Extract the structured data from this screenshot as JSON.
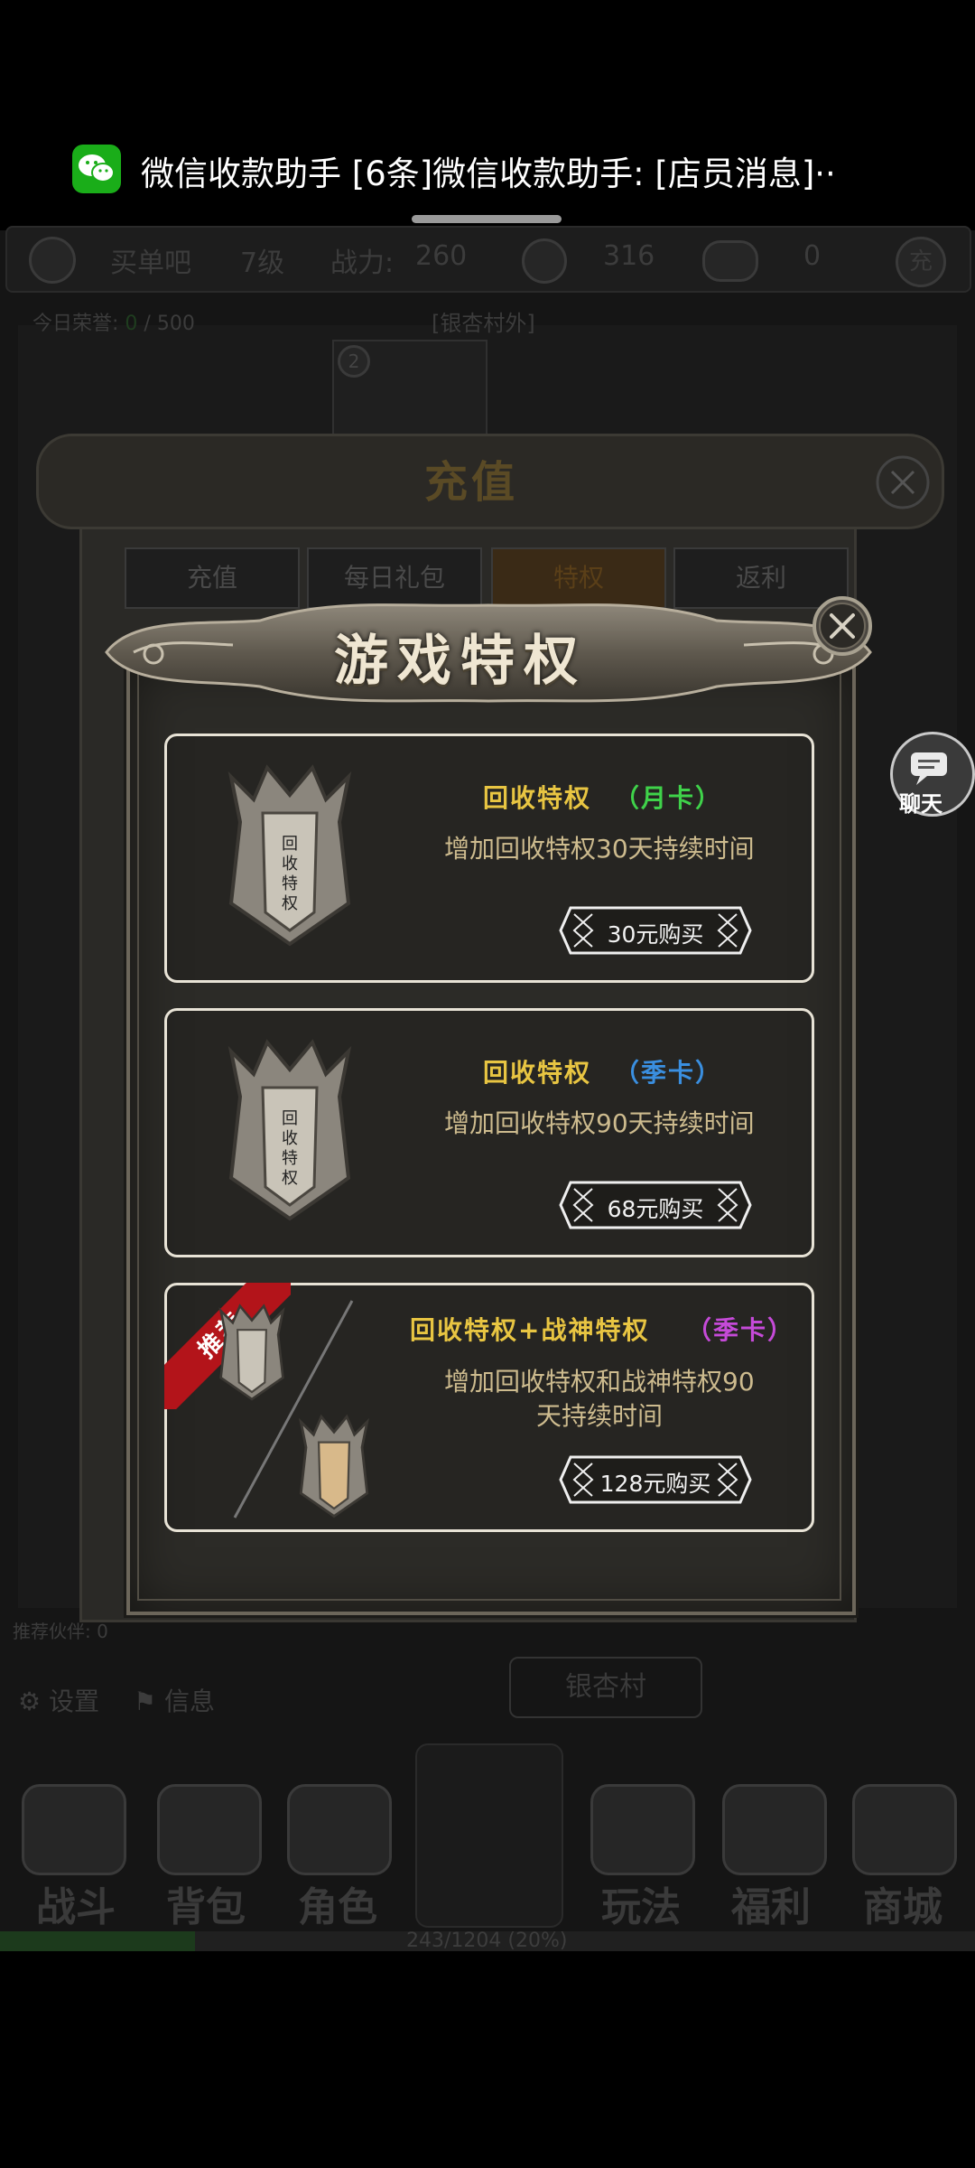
{
  "notification": {
    "app_name": "微信收款助手",
    "message": "[6条]微信收款助手: [店员消息]··"
  },
  "topbar": {
    "shop_name": "买单吧",
    "level": "7级",
    "power_label": "战力:",
    "power_value": "260",
    "coins": "316",
    "ingots": "0",
    "recharge_icon_label": "充"
  },
  "subbar": {
    "honor_label": "今日荣誉:",
    "honor_value": "0",
    "honor_max": "/ 500",
    "location": "[银杏村外]",
    "monster_count": "2"
  },
  "recharge_panel": {
    "title": "充值",
    "tabs": [
      "充值",
      "每日礼包",
      "特权",
      "返利"
    ]
  },
  "chat": {
    "label": "聊天"
  },
  "dialog": {
    "title": "游戏特权",
    "cards": [
      {
        "title": "回收特权",
        "tag": "（月卡）",
        "tag_color": "#3fd24a",
        "description": "增加回收特权30天持续时间",
        "button": "30元购买",
        "shield_label": "回收特权"
      },
      {
        "title": "回收特权",
        "tag": "（季卡）",
        "tag_color": "#3a8fe0",
        "description": "增加回收特权90天持续时间",
        "button": "68元购买",
        "shield_label": "回收特权"
      },
      {
        "title": "回收特权+战神特权",
        "tag": "（季卡）",
        "tag_color": "#c54ad8",
        "description_line1": "增加回收特权和战神特权90",
        "description_line2": "天持续时间",
        "button": "128元购买",
        "ribbon": "推荐"
      }
    ]
  },
  "left_panel": {
    "rank_label": "推荐伙伴:",
    "rank_value": "0",
    "settings": "设置",
    "info": "信息"
  },
  "town_button": "银杏村",
  "bottom_nav": [
    "战斗",
    "背包",
    "角色",
    "玩法",
    "福利",
    "商城"
  ],
  "exp": {
    "label": "243/1204 (20%)",
    "progress": 0.2
  },
  "colors": {
    "gold_title": "#e8c542",
    "desc_text": "#cdbb8e",
    "ribbon_red": "#b3141a",
    "wechat_green": "#1aad19"
  }
}
